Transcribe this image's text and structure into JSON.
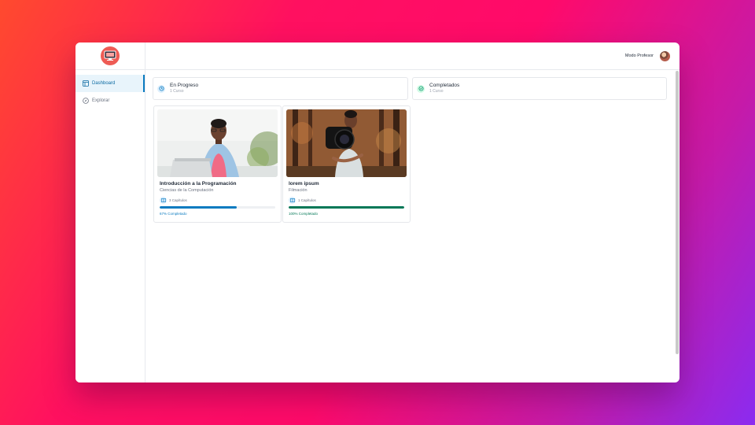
{
  "sidebar": {
    "logo_icon": "monitor-logo-icon",
    "items": [
      {
        "label": "Dashboard",
        "icon": "layout-icon",
        "active": true
      },
      {
        "label": "Explorar",
        "icon": "compass-icon",
        "active": false
      }
    ]
  },
  "header": {
    "teacher_mode_label": "Modo Profesor",
    "avatar": "user-avatar"
  },
  "stats": [
    {
      "title": "En Progreso",
      "subtitle": "1 Curso",
      "icon": "clock-icon",
      "color": "#0b7bc0",
      "bg": "#dbeefc"
    },
    {
      "title": "Completados",
      "subtitle": "1 Curso",
      "icon": "check-circle-icon",
      "color": "#059669",
      "bg": "#d1fae5"
    }
  ],
  "courses": [
    {
      "title": "Introducción a la Programación",
      "category": "Ciencias de la Computación",
      "chapters": "3 Capítulos",
      "progress": 0.67,
      "progress_text": "67% Completado",
      "color": "#0b7bc0",
      "image": "person-with-laptop"
    },
    {
      "title": "lorem ipsum",
      "category": "Filmación",
      "chapters": "1 Capítulos",
      "progress": 1.0,
      "progress_text": "100% Completado",
      "color": "#047857",
      "image": "person-with-camera-forest"
    }
  ],
  "colors": {
    "accent": "#0b7bc0",
    "complete": "#047857"
  }
}
